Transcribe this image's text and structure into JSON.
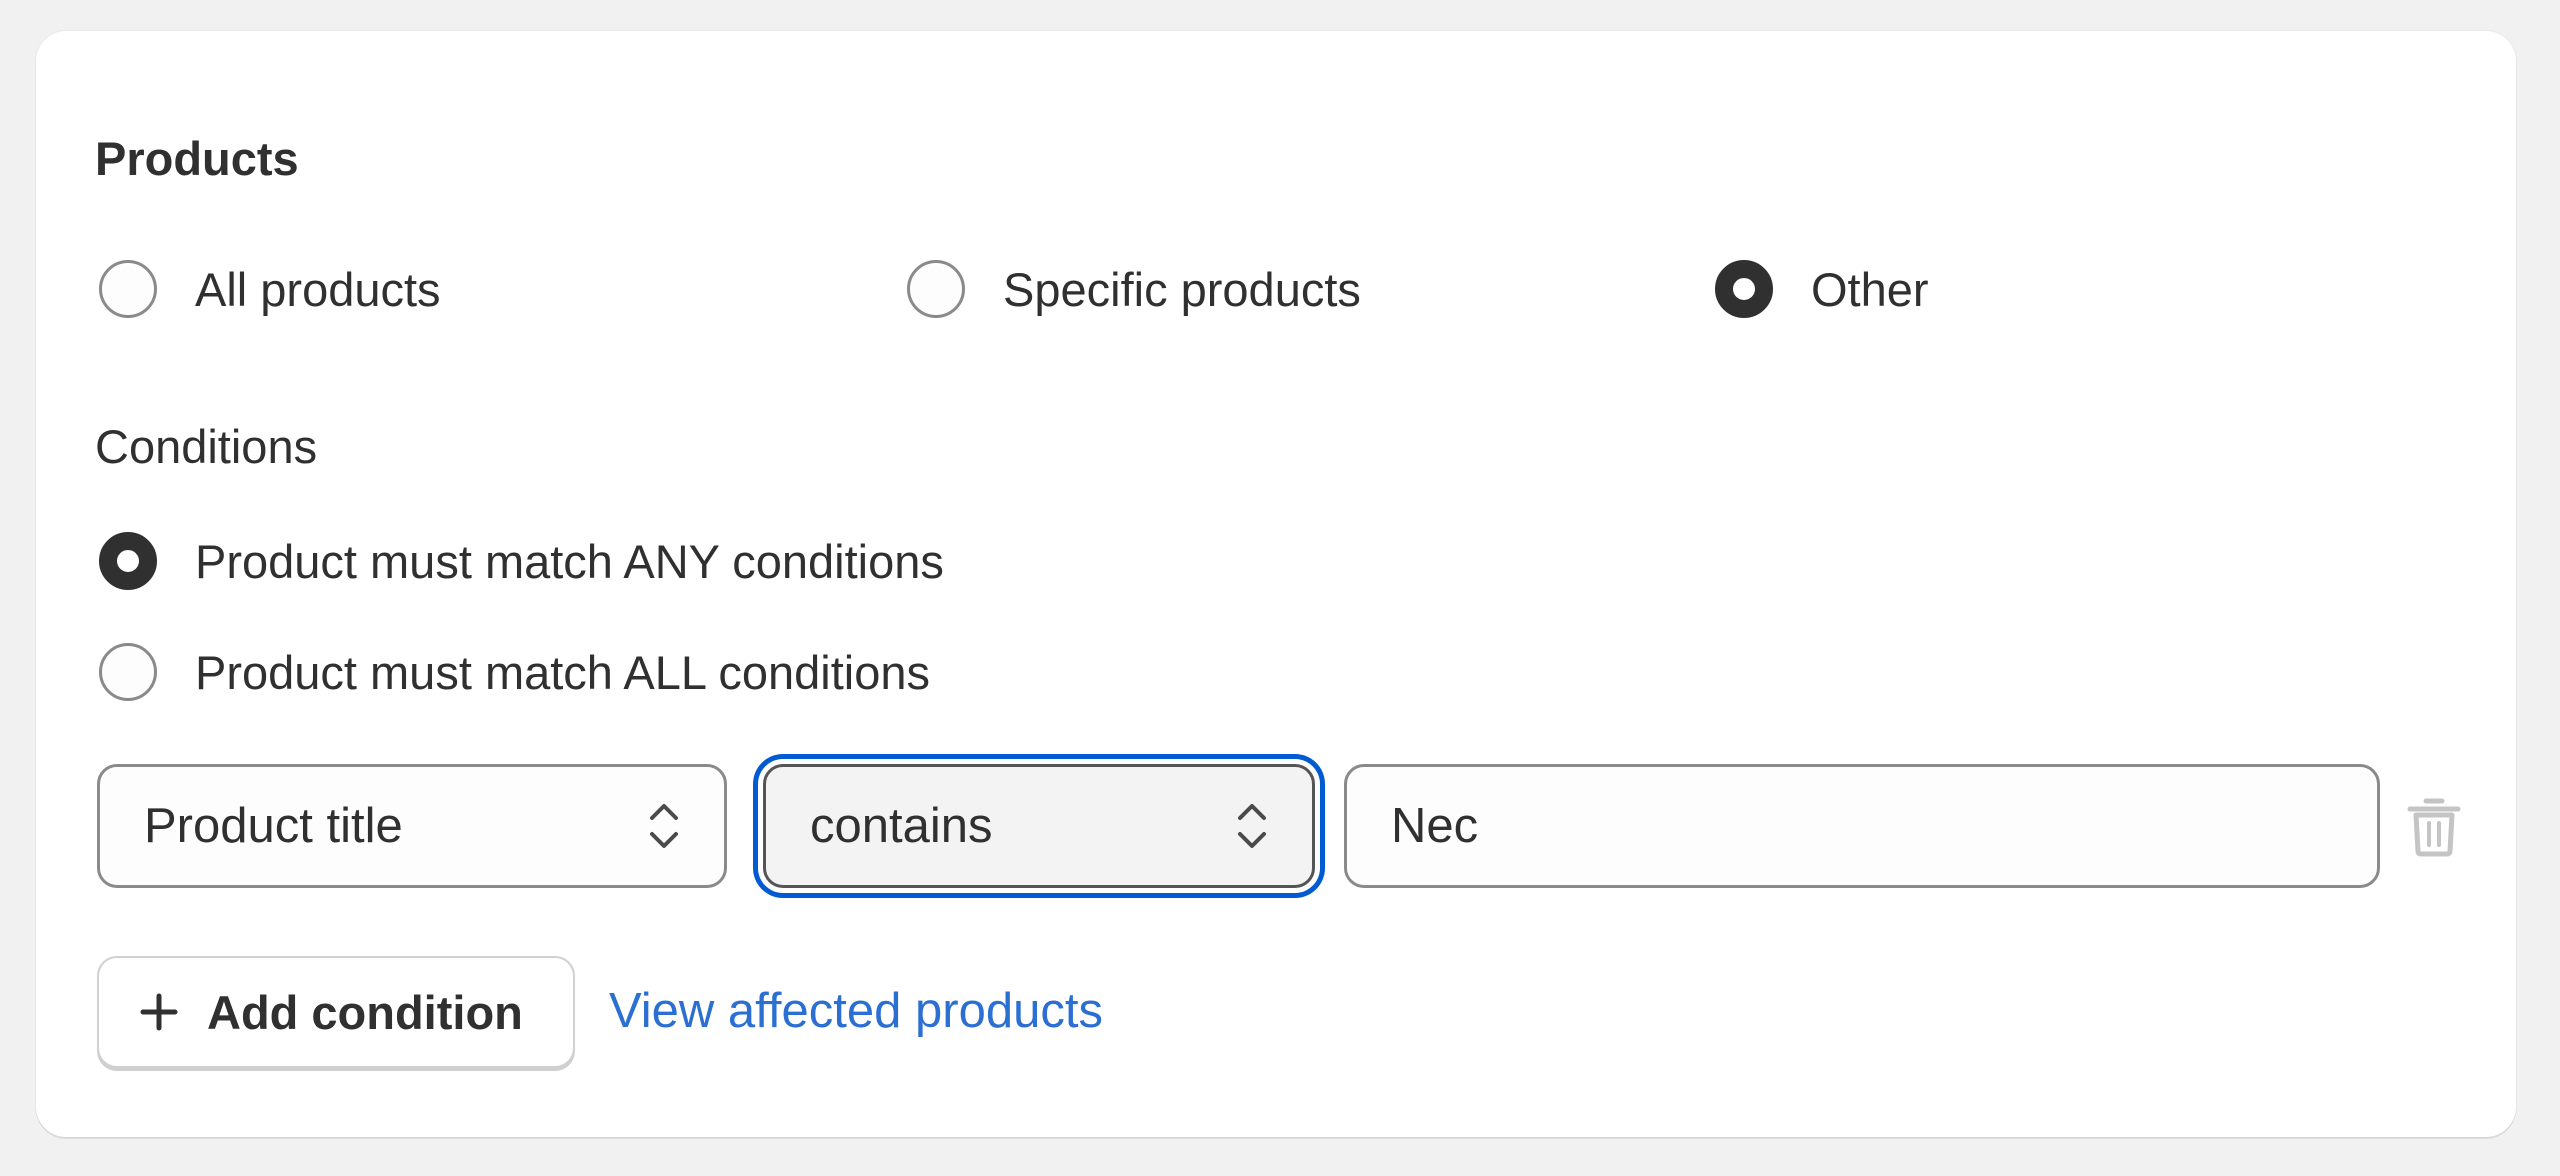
{
  "products_section": {
    "title": "Products",
    "scope_options": [
      {
        "label": "All products",
        "checked": false
      },
      {
        "label": "Specific products",
        "checked": false
      },
      {
        "label": "Other",
        "checked": true
      }
    ]
  },
  "conditions": {
    "heading": "Conditions",
    "match_options": [
      {
        "label": "Product must match ANY conditions",
        "checked": true
      },
      {
        "label": "Product must match ALL conditions",
        "checked": false
      }
    ],
    "rule": {
      "field_select": "Product title",
      "operator_select": "contains",
      "value_input": "Nec"
    },
    "add_condition_label": "Add condition",
    "view_affected_label": "View affected products"
  },
  "colors": {
    "accent_link": "#2a6fd1",
    "focus_ring": "#005bd3",
    "text": "#303030"
  },
  "icons": [
    "chevron-up-down-icon",
    "trash-icon",
    "plus-icon"
  ]
}
